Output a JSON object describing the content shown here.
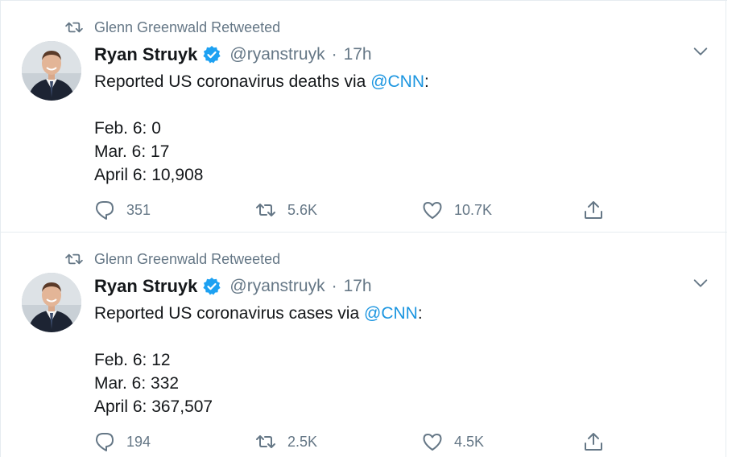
{
  "tweets": [
    {
      "retweeted_by": "Glenn Greenwald Retweeted",
      "author_name": "Ryan Struyk",
      "handle": "@ryanstruyk",
      "separator": "·",
      "time": "17h",
      "text_before": "Reported US coronavirus deaths via ",
      "mention": "@CNN",
      "text_after": ":",
      "lines": [
        "Feb. 6: 0",
        "Mar. 6: 17",
        "April 6: 10,908"
      ],
      "replies": "351",
      "retweets": "5.6K",
      "likes": "10.7K"
    },
    {
      "retweeted_by": "Glenn Greenwald Retweeted",
      "author_name": "Ryan Struyk",
      "handle": "@ryanstruyk",
      "separator": "·",
      "time": "17h",
      "text_before": "Reported US coronavirus cases via ",
      "mention": "@CNN",
      "text_after": ":",
      "lines": [
        "Feb. 6: 12",
        "Mar. 6: 332",
        "April 6: 367,507"
      ],
      "replies": "194",
      "retweets": "2.5K",
      "likes": "4.5K"
    }
  ],
  "icons": {
    "retweeted": "retweet-icon",
    "verified": "verified-badge-icon",
    "caret": "chevron-down-icon",
    "reply": "reply-icon",
    "retweet": "retweet-icon",
    "like": "heart-icon",
    "share": "share-icon"
  },
  "colors": {
    "text": "#14171a",
    "secondary": "#657786",
    "link": "#1b95e0",
    "verified": "#1da1f2",
    "divider": "#e6ecf0"
  }
}
